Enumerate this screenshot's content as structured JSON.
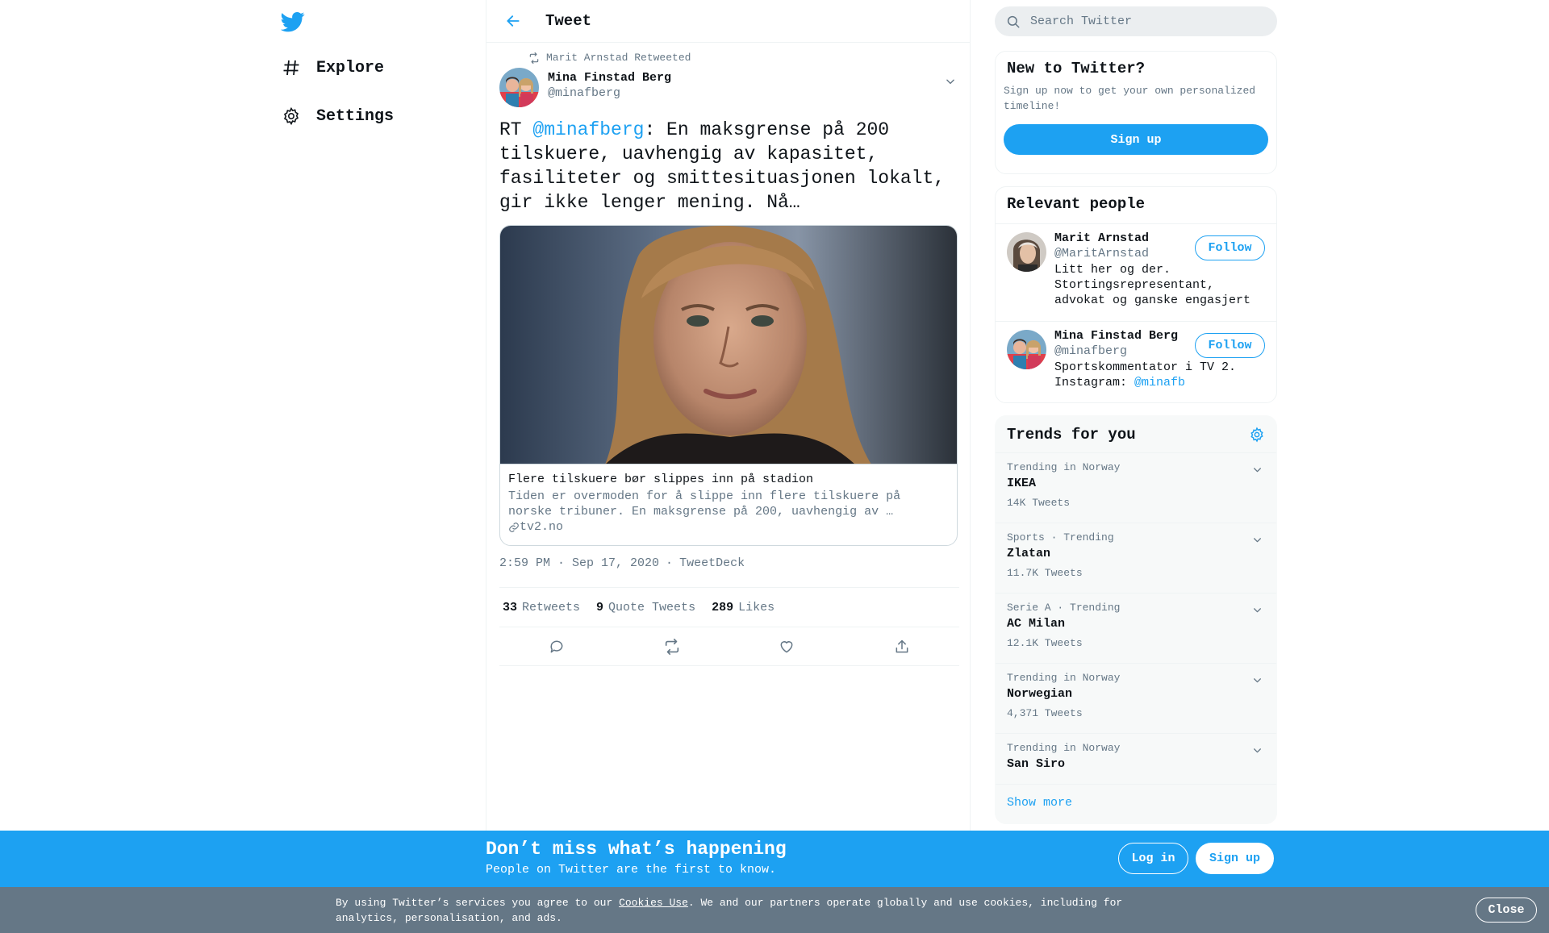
{
  "nav": {
    "logo_icon": "twitter-bird-icon",
    "items": [
      {
        "label": "Explore",
        "icon": "hashtag-icon"
      },
      {
        "label": "Settings",
        "icon": "gear-icon"
      }
    ]
  },
  "header": {
    "title": "Tweet",
    "back_icon": "arrow-left-icon"
  },
  "tweet": {
    "retweeted_by": "Marit Arnstad Retweeted",
    "author_name": "Mina Finstad Berg",
    "author_handle": "@minafberg",
    "text_prefix": "RT ",
    "mention": "@minafberg",
    "text_rest": ": En maksgrense på 200 tilskuere, uavhengig av kapasitet, fasiliteter og smittesituasjonen lokalt, gir ikke lenger mening. Nå…",
    "card": {
      "title": "Flere tilskuere bør slippes inn på stadion",
      "description": "Tiden er overmoden for å slippe inn flere tilskuere på norske tribuner. En maksgrense på 200, uavhengig av …",
      "domain": "tv2.no"
    },
    "time": "2:59 PM · Sep 17, 2020",
    "separator": "·",
    "source": "TweetDeck",
    "stats": {
      "retweets_count": "33",
      "retweets_label": "Retweets",
      "quotes_count": "9",
      "quotes_label": "Quote Tweets",
      "likes_count": "289",
      "likes_label": "Likes"
    }
  },
  "search": {
    "placeholder": "Search Twitter"
  },
  "new_to_twitter": {
    "title": "New to Twitter?",
    "text": "Sign up now to get your own personalized timeline!",
    "button": "Sign up"
  },
  "relevant_people": {
    "title": "Relevant people",
    "people": [
      {
        "name": "Marit Arnstad",
        "handle": "@MaritArnstad",
        "bio": "Litt her og der. Stortingsrepresentant, advokat og ganske engasjert",
        "button": "Follow"
      },
      {
        "name": "Mina Finstad Berg",
        "handle": "@minafberg",
        "bio_prefix": "Sportskommentator i TV 2. Instagram: ",
        "bio_mention": "@minafb",
        "button": "Follow"
      }
    ]
  },
  "trends": {
    "title": "Trends for you",
    "items": [
      {
        "category": "Trending in Norway",
        "name": "IKEA",
        "count": "14K Tweets"
      },
      {
        "category": "Sports · Trending",
        "name": "Zlatan",
        "count": "11.7K Tweets"
      },
      {
        "category": "Serie A · Trending",
        "name": "AC Milan",
        "count": "12.1K Tweets"
      },
      {
        "category": "Trending in Norway",
        "name": "Norwegian",
        "count": "4,371 Tweets"
      },
      {
        "category": "Trending in Norway",
        "name": "San Siro",
        "count": ""
      }
    ],
    "show_more": "Show more"
  },
  "banner": {
    "title": "Don’t miss what’s happening",
    "subtitle": "People on Twitter are the first to know.",
    "login": "Log in",
    "signup": "Sign up"
  },
  "cookie": {
    "text_before": "By using Twitter’s services you agree to our ",
    "link": "Cookies Use",
    "text_after": ". We and our partners operate globally and use cookies, including for analytics, personalisation, and ads.",
    "close": "Close"
  },
  "colors": {
    "accent": "#1da1f2",
    "muted": "#657786",
    "cookie_bg": "#657786"
  }
}
